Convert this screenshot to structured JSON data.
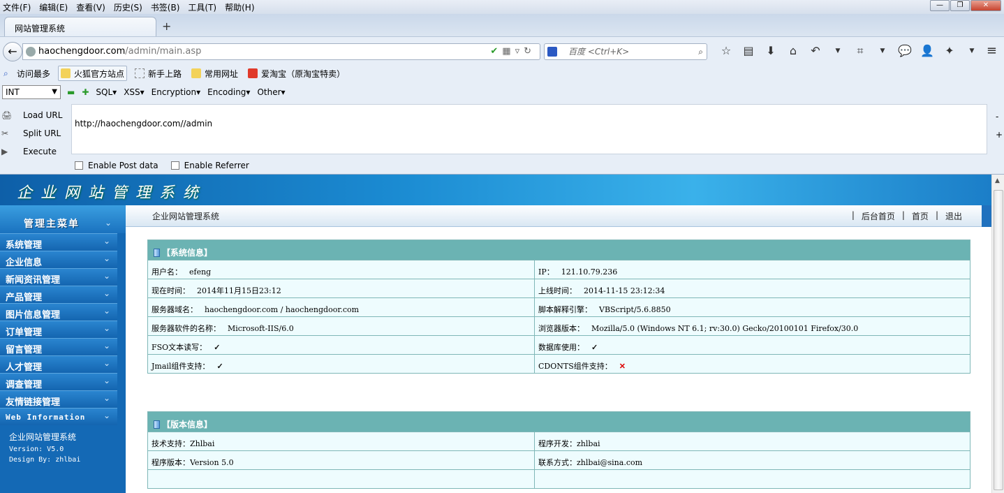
{
  "menubar": [
    "文件(F)",
    "编辑(E)",
    "查看(V)",
    "历史(S)",
    "书签(B)",
    "工具(T)",
    "帮助(H)"
  ],
  "tab": {
    "title": "网站管理系统",
    "new": "+"
  },
  "url": {
    "host": "haochengdoor.com",
    "path": "/admin/main.asp"
  },
  "search": {
    "placeholder": "百度 <Ctrl+K>"
  },
  "bookmarks": [
    "访问最多",
    "火狐官方站点",
    "新手上路",
    "常用网址",
    "爱淘宝（原淘宝特卖）"
  ],
  "hackbar": {
    "select": "INT",
    "menus": [
      "SQL▾",
      "XSS▾",
      "Encryption▾",
      "Encoding▾",
      "Other▾"
    ],
    "actions": [
      "Load URL",
      "Split URL",
      "Execute"
    ],
    "text": "http://haochengdoor.com//admin",
    "checks": [
      "Enable Post data",
      "Enable Referrer"
    ]
  },
  "banner": {
    "title": "企业网站管理系统"
  },
  "sidebar": {
    "head": "管理主菜单",
    "items": [
      "系统管理",
      "企业信息",
      "新闻资讯管理",
      "产品管理",
      "图片信息管理",
      "订单管理",
      "留言管理",
      "人才管理",
      "调查管理",
      "友情链接管理",
      "Web Information"
    ],
    "info": {
      "name": "企业网站管理系统",
      "version": "Version: V5.0",
      "design": "Design By: zhlbai"
    },
    "num": "3"
  },
  "mainhdr": {
    "title": "企业网站管理系统",
    "links": [
      "后台首页",
      "首页",
      "退出"
    ]
  },
  "sysinfo": {
    "title": "【系统信息】",
    "rows": [
      [
        {
          "k": "用户名：",
          "v": "efeng"
        },
        {
          "k": "IP：",
          "v": "121.10.79.236"
        }
      ],
      [
        {
          "k": "现在时间：",
          "v": "2014年11月15日23:12"
        },
        {
          "k": "上线时间：",
          "v": "2014-11-15 23:12:34"
        }
      ],
      [
        {
          "k": "服务器域名：",
          "v": "haochengdoor.com / haochengdoor.com"
        },
        {
          "k": "脚本解释引擎：",
          "v": "VBScript/5.6.8850"
        }
      ],
      [
        {
          "k": "服务器软件的名称：",
          "v": "Microsoft-IIS/6.0"
        },
        {
          "k": "浏览器版本：",
          "v": "Mozilla/5.0 (Windows NT 6.1; rv:30.0) Gecko/20100101 Firefox/30.0"
        }
      ],
      [
        {
          "k": "FSO文本读写：",
          "v": "✓"
        },
        {
          "k": "数据库使用：",
          "v": "✓"
        }
      ],
      [
        {
          "k": "Jmail组件支持：",
          "v": "✓"
        },
        {
          "k": "CDONTS组件支持：",
          "v": "✕"
        }
      ]
    ]
  },
  "verinfo": {
    "title": "【版本信息】",
    "rows": [
      [
        {
          "k": "技术支持：",
          "v": "Zhlbai"
        },
        {
          "k": "程序开发：",
          "v": "zhlbai"
        }
      ],
      [
        {
          "k": "程序版本：",
          "v": "Version 5.0"
        },
        {
          "k": "联系方式：",
          "v": "zhlbai@sina.com"
        }
      ]
    ]
  }
}
